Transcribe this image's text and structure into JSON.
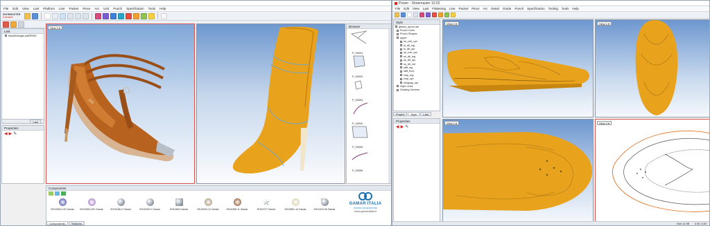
{
  "left_app": {
    "title": "",
    "brand_top": "SHOEMASTER",
    "brand_bottom": "Creative",
    "menu": [
      "File",
      "Edit",
      "View",
      "Last",
      "Platform",
      "Line",
      "Packet",
      "Piece",
      "Arc",
      "Unit",
      "Punch",
      "Specification",
      "Tools",
      "Help"
    ],
    "last_panel": {
      "title": "Last",
      "item": "ModelDesignLastREMO"
    },
    "properties_title": "Properties",
    "tree_tabs": [
      "Last"
    ],
    "view_label": "View 1",
    "browser": {
      "title": "Browser",
      "items": [
        "P_00001",
        "P_00002",
        "P_00003",
        "P_00004",
        "P_00005",
        "P_00006"
      ]
    },
    "components": {
      "title": "Components",
      "items": [
        "SH10063-14V Gamar",
        "SH10063-20V Gamar",
        "SH10186-V Gamar",
        "SH10393-V Gamar",
        "SH10304 Gamar",
        "SH10320-12 Gamar",
        "SH10455-11 Gamar",
        "SH10727 Gamar",
        "SH10851-14 Gamar",
        "SH11010-06 Gamar"
      ],
      "tabs": [
        "Components",
        "Textures"
      ],
      "brand_name": "GAMAR ITALIA",
      "brand_sub": "shoes components",
      "brand_url": "www.gamaritalia.it"
    }
  },
  "right_app": {
    "title": "Power - Shoemaster 10.02",
    "menu": [
      "File",
      "Edit",
      "View",
      "Last",
      "Flattening",
      "Line",
      "Packet",
      "Piece",
      "Arc",
      "Detail",
      "Grade",
      "Punch",
      "Specification",
      "Tooling",
      "Tools",
      "Help"
    ],
    "style_title": "Style",
    "tree": [
      "gibson_apron.sts",
      "Punch Lines",
      "Punch Shapes",
      "upper",
      "ss_cntr_upr",
      "ls_dtl_lng",
      "ls_dtl_upr",
      "ss_cntr_upr",
      "ss_dtl_lng",
      "ss_dtl_upr",
      "ss_dtl_cut",
      "stfff_lng",
      "stfff_frcnt",
      "vmp_lng",
      "vmp_upr",
      "wingcap_upr",
      "Style Lines",
      "Grading Centres"
    ],
    "tree_tabs": [
      "Project",
      "Style",
      "Last"
    ],
    "properties_title": "Properties",
    "views": [
      "View 1",
      "View 1",
      "View 1",
      "View 2"
    ],
    "status": [
      "Size 11.5B",
      "0.00, 0.00"
    ]
  },
  "colors": {
    "accent_red": "#d9534f",
    "shoe_gold": "#e8a21c",
    "shoe_tan": "#b8621f"
  }
}
